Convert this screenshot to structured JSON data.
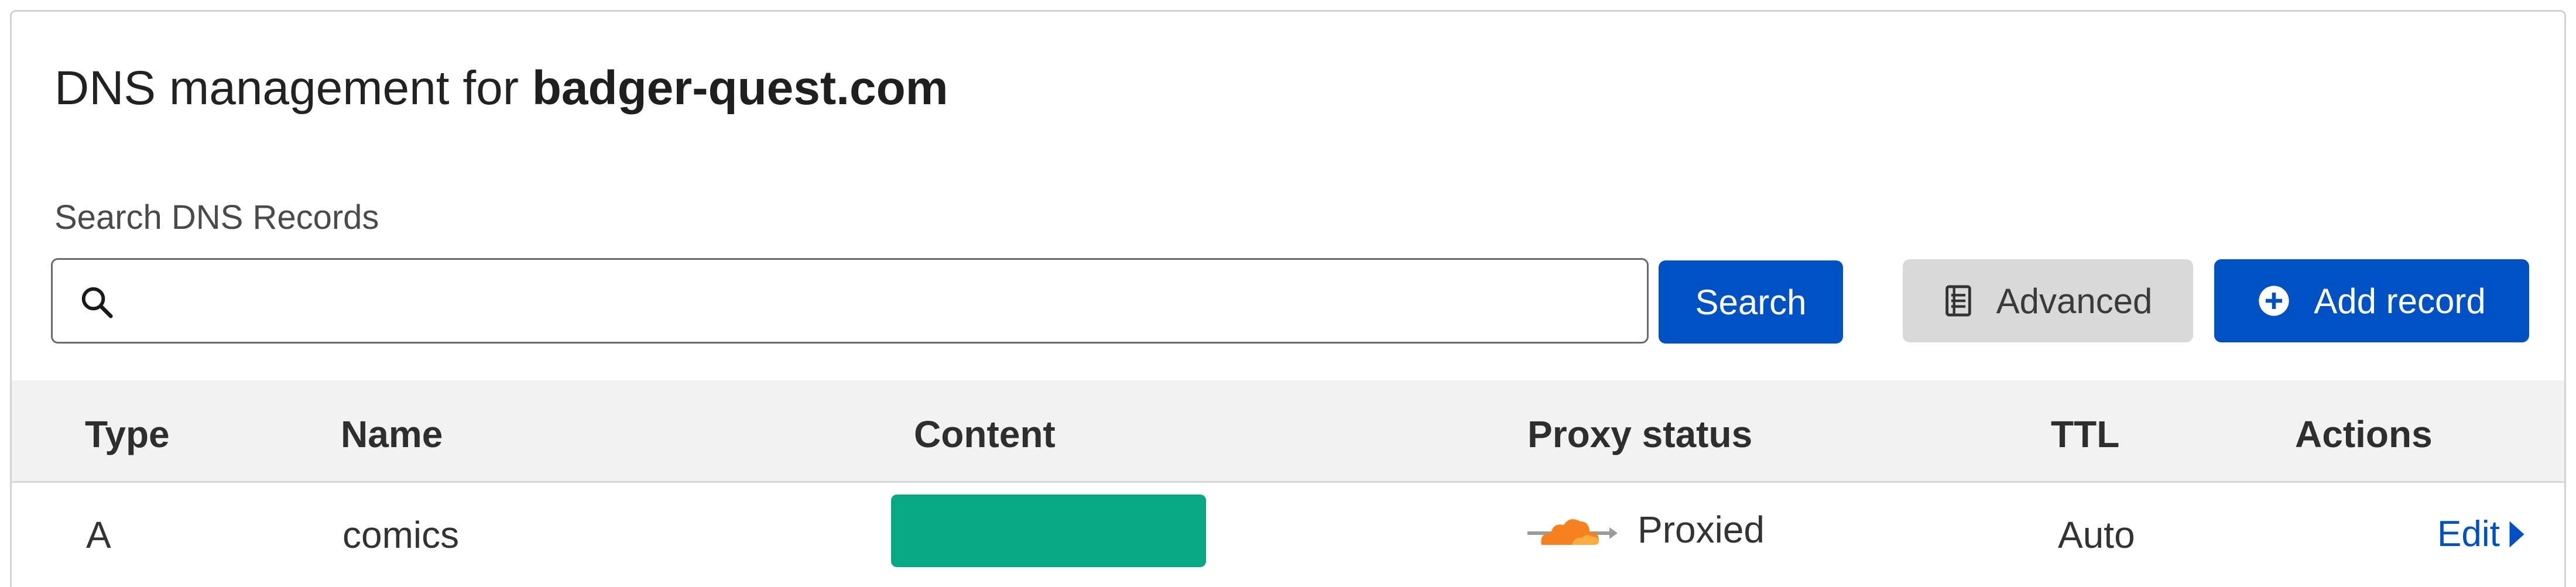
{
  "header": {
    "title_prefix": "DNS management for",
    "domain": "badger-quest.com"
  },
  "search": {
    "label": "Search DNS Records",
    "value": "",
    "placeholder": "",
    "icon": "search-icon",
    "button_label": "Search"
  },
  "toolbar": {
    "advanced_label": "Advanced",
    "advanced_icon": "document-icon",
    "add_record_label": "Add record",
    "add_record_icon": "plus-circle-icon"
  },
  "table": {
    "columns": [
      "Type",
      "Name",
      "Content",
      "Proxy status",
      "TTL",
      "Actions"
    ],
    "rows": [
      {
        "type": "A",
        "name": "comics",
        "content": "",
        "content_redacted": true,
        "content_color": "#09a884",
        "proxy_status": "Proxied",
        "proxy_icon": "cloud-icon",
        "ttl": "Auto",
        "action": "Edit",
        "action_icon": "caret-right-icon"
      }
    ]
  },
  "colors": {
    "primary": "#0051c3",
    "secondary_button": "#d9d9d9",
    "cloud_orange": "#f6821f",
    "redaction": "#09a884"
  }
}
